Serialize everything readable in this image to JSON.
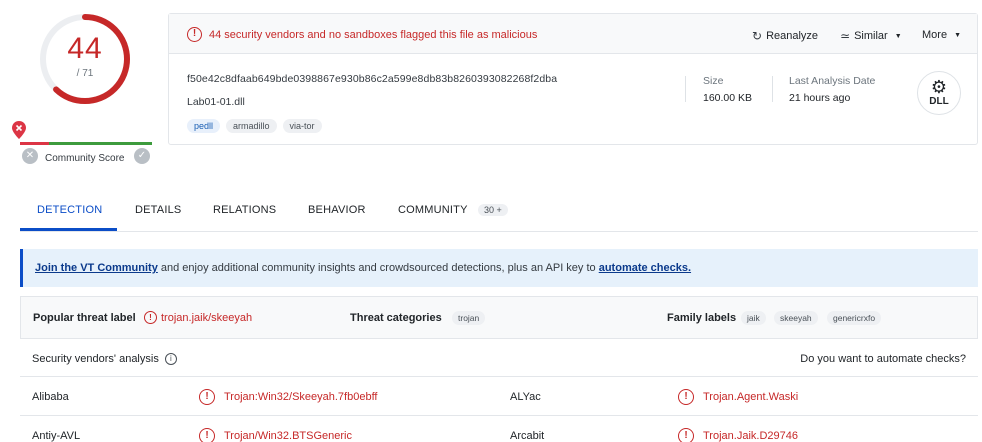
{
  "score": {
    "detections": "44",
    "total": "/ 71",
    "community_label": "Community Score",
    "ring_fraction": 0.62,
    "ring_color": "#c62828"
  },
  "header": {
    "alert_text": "44 security vendors and no sandboxes flagged this file as malicious",
    "actions": {
      "reanalyze": "Reanalyze",
      "similar": "Similar",
      "more": "More"
    },
    "hash": "f50e42c8dfaab649bde0398867e930b86c2a599e8db83b8260393082268f2dba",
    "filename": "Lab01-01.dll",
    "tags": [
      "pedll",
      "armadillo",
      "via-tor"
    ],
    "size_label": "Size",
    "size_value": "160.00 KB",
    "last_analysis_label": "Last Analysis Date",
    "last_analysis_value": "21 hours ago",
    "file_type": "DLL"
  },
  "tabs": {
    "detection": "DETECTION",
    "details": "DETAILS",
    "relations": "RELATIONS",
    "behavior": "BEHAVIOR",
    "community": "COMMUNITY",
    "community_badge": "30 +"
  },
  "banner": {
    "link1": "Join the VT Community",
    "middle": " and enjoy additional community insights and crowdsourced detections, plus an API key to ",
    "link2": "automate checks."
  },
  "threat": {
    "popular_label": "Popular threat label",
    "popular_value": "trojan.jaik/skeeyah",
    "categories_label": "Threat categories",
    "categories": [
      "trojan"
    ],
    "family_label": "Family labels",
    "families": [
      "jaik",
      "skeeyah",
      "genericrxfo"
    ]
  },
  "vendors_head": {
    "title": "Security vendors' analysis",
    "automate": "Do you want to automate checks?"
  },
  "vendors": [
    {
      "left_name": "Alibaba",
      "left_result": "Trojan:Win32/Skeeyah.7fb0ebff",
      "right_name": "ALYac",
      "right_result": "Trojan.Agent.Waski"
    },
    {
      "left_name": "Antiy-AVL",
      "left_result": "Trojan/Win32.BTSGeneric",
      "right_name": "Arcabit",
      "right_result": "Trojan.Jaik.D29746"
    }
  ]
}
